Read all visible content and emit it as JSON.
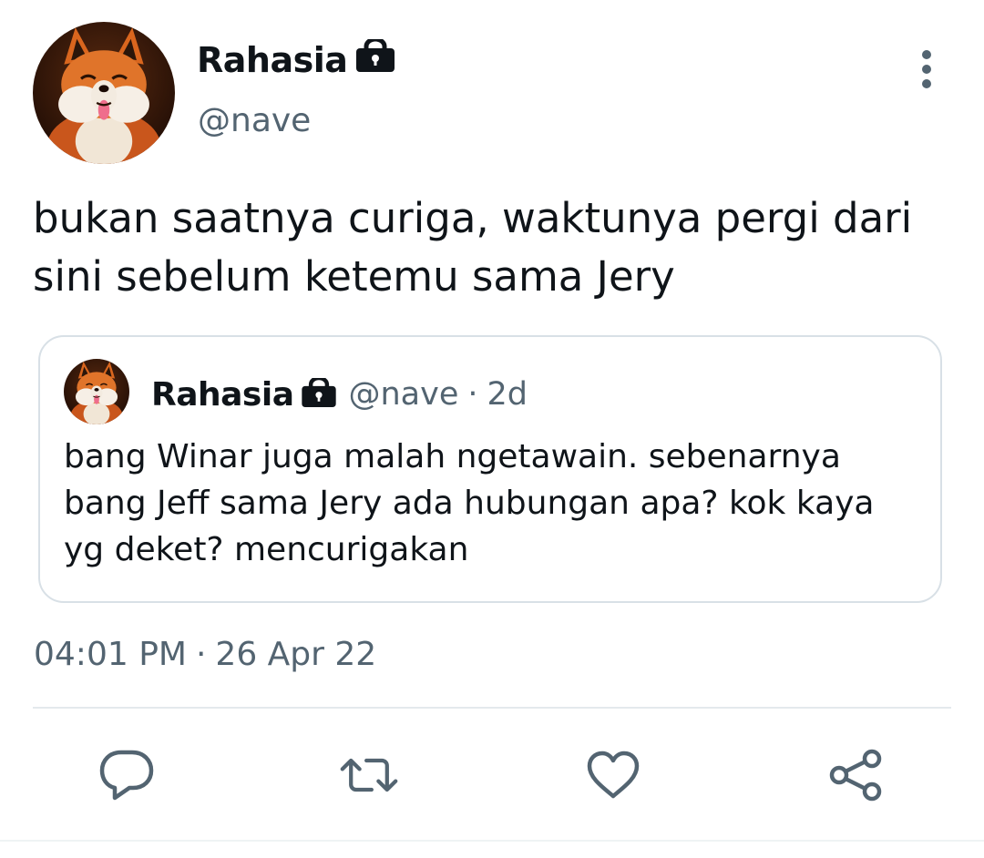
{
  "tweet": {
    "author": {
      "display_name": "Rahasia",
      "handle": "@nave",
      "protected_icon": "lock-icon",
      "avatar": "fox-avatar"
    },
    "text": "bukan saatnya curiga, waktunya pergi dari sini sebelum ketemu sama Jery",
    "more_icon": "more-vertical-icon",
    "quoted": {
      "display_name": "Rahasia",
      "handle": "@nave",
      "separator": "·",
      "time": "2d",
      "text": "bang Winar juga malah ngetawain. sebenarnya bang Jeff sama Jery ada hubungan apa? kok kaya yg deket? mencurigakan"
    },
    "time": "04:01 PM",
    "time_separator": "·",
    "date": "26 Apr 22"
  },
  "actions": [
    {
      "name": "reply",
      "icon": "reply-icon"
    },
    {
      "name": "retweet",
      "icon": "retweet-icon"
    },
    {
      "name": "like",
      "icon": "heart-icon"
    },
    {
      "name": "share",
      "icon": "share-icon"
    }
  ],
  "colors": {
    "text_primary": "#0f1419",
    "text_secondary": "#536471",
    "border": "#d8e0e6",
    "icon": "#536471"
  }
}
